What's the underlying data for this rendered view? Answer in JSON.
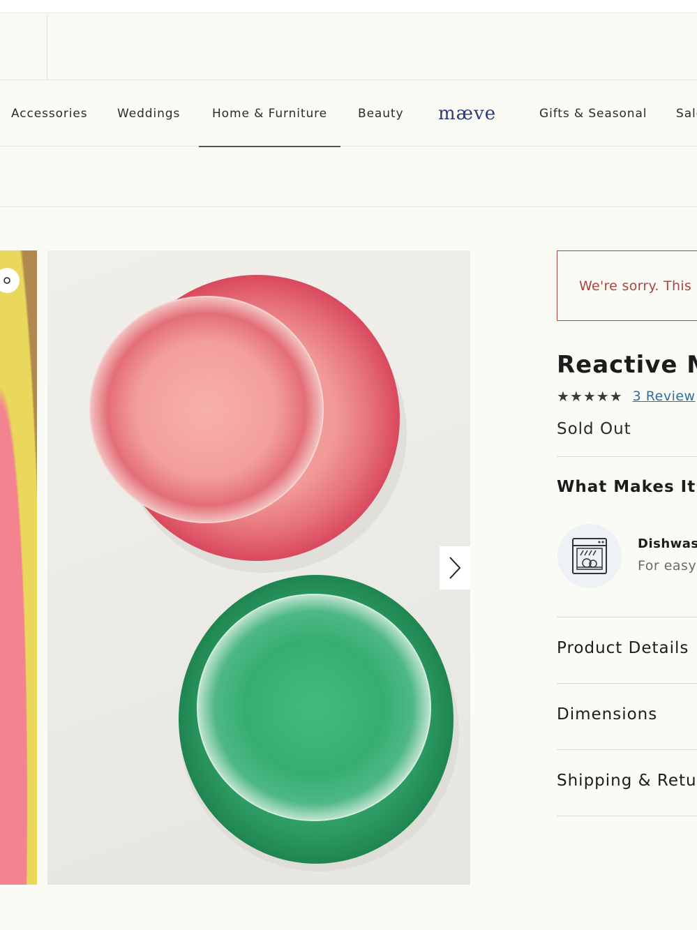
{
  "nav": {
    "items": [
      {
        "label": "Accessories"
      },
      {
        "label": "Weddings"
      },
      {
        "label": "Home & Furniture"
      },
      {
        "label": "Beauty"
      },
      {
        "label": "mæve"
      },
      {
        "label": "Gifts & Seasonal"
      },
      {
        "label": "Sale"
      }
    ],
    "active_index": 2
  },
  "gallery": {
    "next_icon": "chevron-right-icon",
    "plates": [
      {
        "color": "#e7747a"
      },
      {
        "color": "#2fa468"
      }
    ]
  },
  "product": {
    "alert": "We're sorry. This",
    "title": "Reactive Me",
    "stars": "★★★★★",
    "rating_value": 4.5,
    "reviews_label": "3 Review",
    "status": "Sold Out",
    "what_makes_title": "What Makes It G",
    "feature": {
      "icon": "dishwasher-icon",
      "title": "Dishwash",
      "subtitle": "For easy"
    },
    "accordions": [
      {
        "label": "Product Details"
      },
      {
        "label": "Dimensions"
      },
      {
        "label": "Shipping & Retur"
      }
    ]
  },
  "colors": {
    "alert": "#a94442",
    "link": "#2f6f9e",
    "maeve": "#2d3a7a",
    "background": "#fbfbf6"
  }
}
